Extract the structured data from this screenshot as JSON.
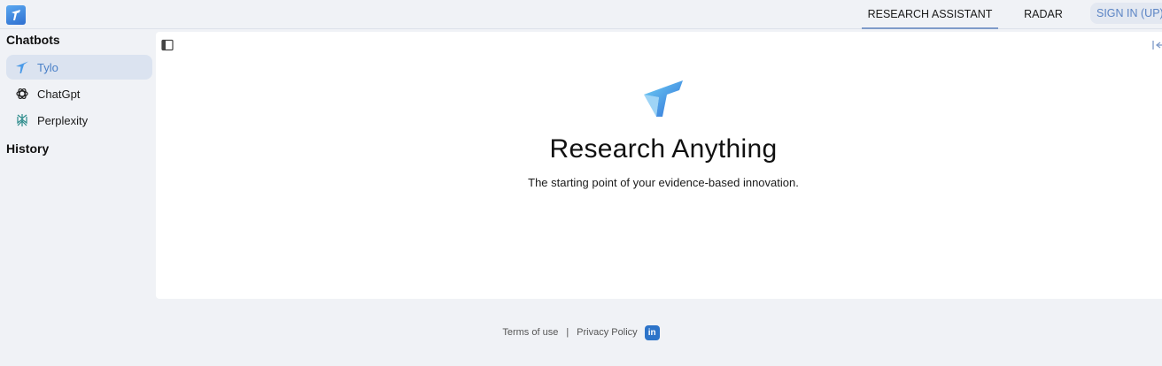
{
  "topbar": {
    "logo_icon": "tylo-logo-icon",
    "tabs": [
      {
        "label": "RESEARCH ASSISTANT",
        "active": true
      },
      {
        "label": "RADAR",
        "active": false
      }
    ],
    "signin_label": "SIGN IN (UP)"
  },
  "sidebar": {
    "chatbots_title": "Chatbots",
    "items": [
      {
        "label": "Tylo",
        "icon": "tylo-icon",
        "active": true
      },
      {
        "label": "ChatGpt",
        "icon": "chatgpt-icon",
        "active": false
      },
      {
        "label": "Perplexity",
        "icon": "perplexity-icon",
        "active": false
      }
    ],
    "history_title": "History"
  },
  "main": {
    "title": "Research Anything",
    "subtitle": "The starting point of your evidence-based innovation."
  },
  "footer": {
    "terms": "Terms of use",
    "separator": "|",
    "privacy": "Privacy Policy",
    "linkedin": "in"
  },
  "colors": {
    "background": "#f0f2f6",
    "accent": "#4a80c8",
    "active_item_bg": "#dbe3f0",
    "linkedin": "#2d74c9"
  }
}
